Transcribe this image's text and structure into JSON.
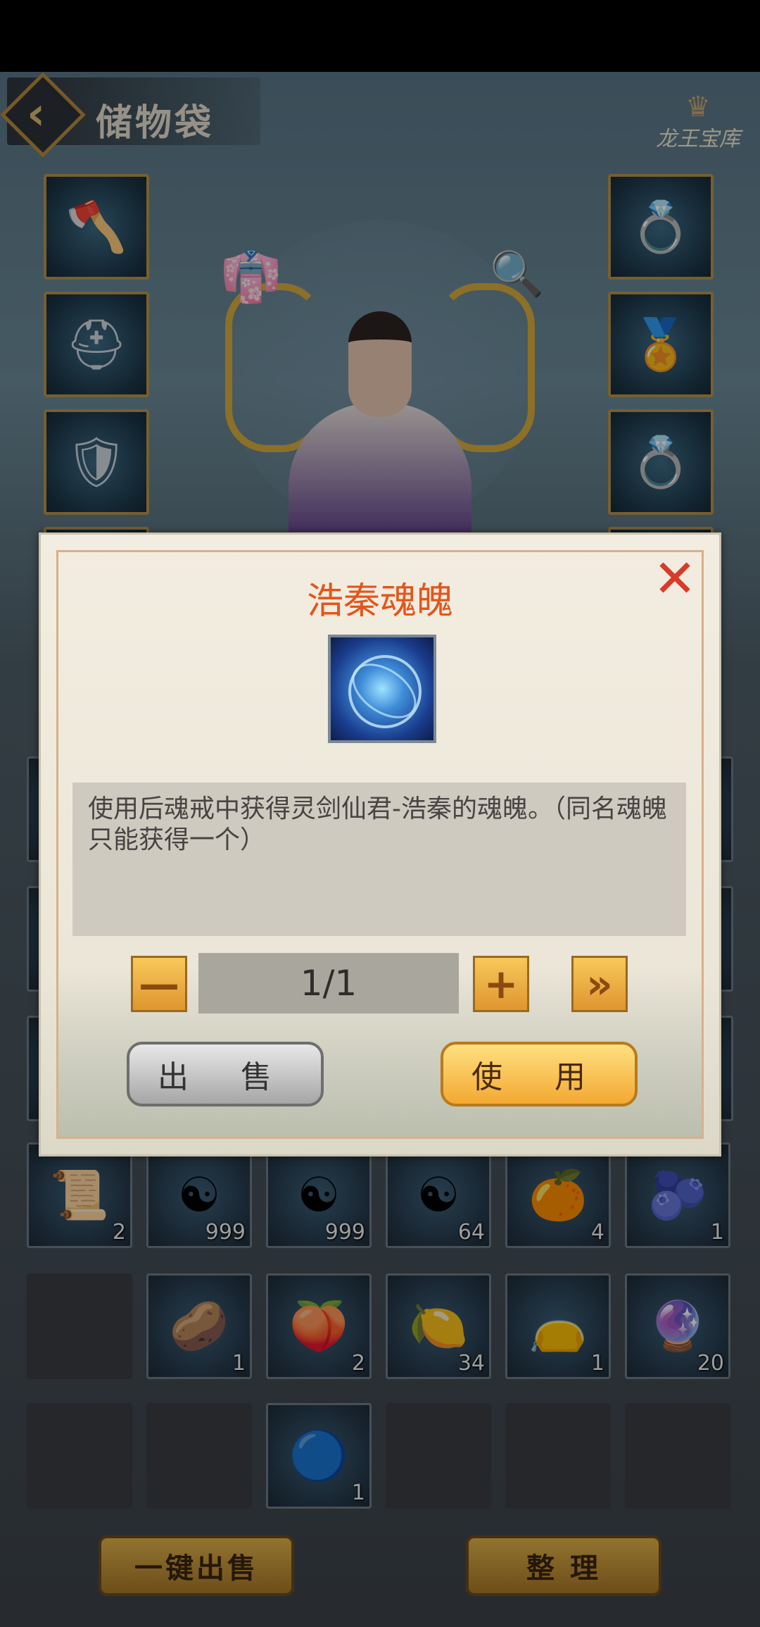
{
  "header": {
    "title": "储物袋",
    "logo_text": "龙王宝库"
  },
  "equipment": {
    "left": [
      {
        "icon": "axe-icon",
        "glyph": "🪓"
      },
      {
        "icon": "helmet-icon",
        "glyph": "⛑"
      },
      {
        "icon": "armor-icon",
        "glyph": "🛡"
      }
    ],
    "right": [
      {
        "icon": "ring-icon",
        "glyph": "💍"
      },
      {
        "icon": "pendant-icon",
        "glyph": "🏅"
      },
      {
        "icon": "gold-ring-icon",
        "glyph": "💍"
      }
    ]
  },
  "inventory": {
    "row1": [
      {
        "icon": "scroll-icon",
        "glyph": "📜",
        "count": "2"
      },
      {
        "icon": "yinyang-gourd-icon",
        "glyph": "☯",
        "count": "999"
      },
      {
        "icon": "yinyang-gourd-icon",
        "glyph": "☯",
        "count": "999"
      },
      {
        "icon": "yinyang-gourd-icon",
        "glyph": "☯",
        "count": "64"
      },
      {
        "icon": "fruit-icon",
        "glyph": "🍊",
        "count": "4"
      },
      {
        "icon": "blue-berries-icon",
        "glyph": "🫐",
        "count": "1"
      }
    ],
    "row2": [
      {
        "icon": "empty",
        "glyph": "",
        "count": ""
      },
      {
        "icon": "seed-icon",
        "glyph": "🥔",
        "count": "1"
      },
      {
        "icon": "peach-icon",
        "glyph": "🍑",
        "count": "2"
      },
      {
        "icon": "golden-fruit-icon",
        "glyph": "🍋",
        "count": "34"
      },
      {
        "icon": "pouch-icon",
        "glyph": "👝",
        "count": "1"
      },
      {
        "icon": "spirit-stone-icon",
        "glyph": "🔮",
        "count": "20"
      }
    ],
    "row3": [
      {
        "icon": "empty",
        "glyph": "",
        "count": ""
      },
      {
        "icon": "empty",
        "glyph": "",
        "count": ""
      },
      {
        "icon": "soul-orb-icon",
        "glyph": "🔵",
        "count": "1"
      },
      {
        "icon": "empty",
        "glyph": "",
        "count": ""
      },
      {
        "icon": "empty",
        "glyph": "",
        "count": ""
      },
      {
        "icon": "empty",
        "glyph": "",
        "count": ""
      }
    ]
  },
  "bottom_buttons": {
    "sell_all": "一键出售",
    "arrange": "整 理"
  },
  "modal": {
    "title": "浩秦魂魄",
    "description": "使用后魂戒中获得灵剑仙君-浩秦的魂魄。（同名魂魄只能获得一个）",
    "quantity": "1/1",
    "minus": "—",
    "plus": "+",
    "max": "»",
    "close": "✕",
    "sell_label": "出 售",
    "use_label": "使 用"
  },
  "colors": {
    "title_orange": "#e2561c",
    "close_red": "#d73b2a",
    "gold_button": "#f3a832"
  }
}
